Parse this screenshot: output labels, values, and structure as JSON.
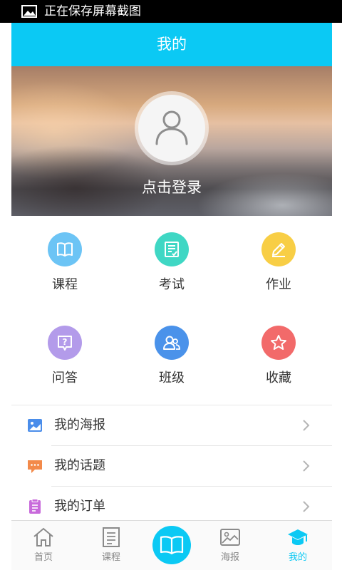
{
  "status_bar": {
    "text": "正在保存屏幕截图",
    "icon": "image-icon"
  },
  "header": {
    "title": "我的"
  },
  "profile": {
    "login_label": "点击登录",
    "avatar_icon": "user-icon"
  },
  "grid": [
    {
      "label": "课程",
      "icon": "book-icon",
      "color": "#6cc4f5"
    },
    {
      "label": "考试",
      "icon": "exam-icon",
      "color": "#3fd7c4"
    },
    {
      "label": "作业",
      "icon": "pencil-icon",
      "color": "#f8ce45"
    },
    {
      "label": "问答",
      "icon": "question-icon",
      "color": "#b39bea"
    },
    {
      "label": "班级",
      "icon": "class-icon",
      "color": "#4a92ea"
    },
    {
      "label": "收藏",
      "icon": "star-icon",
      "color": "#f26a6a"
    }
  ],
  "menu": [
    {
      "label": "我的海报",
      "icon": "poster-icon",
      "color": "#4a8dea"
    },
    {
      "label": "我的话题",
      "icon": "topic-icon",
      "color": "#f38a4a"
    },
    {
      "label": "我的订单",
      "icon": "order-icon",
      "color": "#c86adb"
    }
  ],
  "bottom_nav": {
    "items": [
      {
        "label": "首页",
        "icon": "home-icon"
      },
      {
        "label": "课程",
        "icon": "course-list-icon"
      },
      {
        "label": "",
        "icon": "open-book-icon"
      },
      {
        "label": "海报",
        "icon": "picture-icon"
      },
      {
        "label": "我的",
        "icon": "graduation-cap-icon",
        "active": true
      }
    ],
    "accent_color": "#0bc9f4"
  },
  "colors": {
    "primary": "#0bc9f4"
  }
}
